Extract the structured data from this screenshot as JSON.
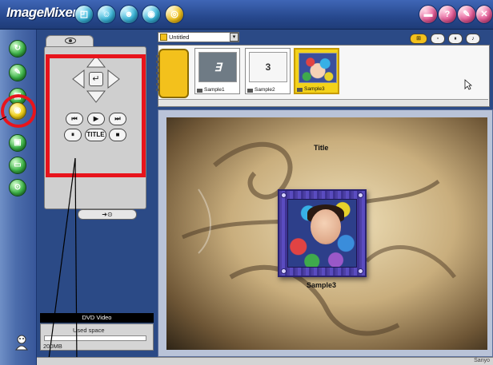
{
  "app": {
    "name": "ImageMixer"
  },
  "topbar": {
    "left_icons": [
      "frame-icon",
      "smile-icon",
      "person-icon",
      "disc-icon",
      "burn-icon"
    ],
    "right_icons": [
      "minimize-icon",
      "help-icon",
      "tools-icon",
      "close-icon"
    ],
    "colors": {
      "background": "#27488d",
      "teal_button": "#3bb6d9",
      "yellow_button": "#f1c21b",
      "pink_button": "#e55b97"
    }
  },
  "rail": {
    "items": [
      "capture-icon",
      "edit-icon",
      "album-icon",
      "dvd-icon",
      "print-icon",
      "export-icon",
      "db-icon"
    ],
    "active": "dvd-icon",
    "colors": {
      "highlight": "#e8141c",
      "active": "#f2d31c",
      "normal": "#3fb54a"
    }
  },
  "controls": {
    "tab_icon": "eye-icon",
    "enter_glyph": "↵",
    "buttons": {
      "prev": "⏮",
      "play": "▶",
      "next": "⏭",
      "pause": "⏸",
      "title": "TITLE",
      "stop": "■"
    },
    "slider_glyph": "➜⊙"
  },
  "disc": {
    "label": "DVD Video",
    "used_space_label": "Used space",
    "size": "200MB"
  },
  "album": {
    "name": "Untitled",
    "dropdown_glyph": "▾",
    "view_buttons": [
      "⊞",
      "▫",
      "⏸",
      "♪"
    ],
    "thumbnails": [
      {
        "caption": "Sample1",
        "glyph": "∃",
        "selected": false
      },
      {
        "caption": "Sample2",
        "glyph": "3",
        "selected": false
      },
      {
        "caption": "Sample3",
        "glyph": "",
        "selected": true
      }
    ]
  },
  "preview": {
    "title": "Title",
    "caption": "Sample3"
  },
  "status": {
    "right": "Sanyo"
  }
}
